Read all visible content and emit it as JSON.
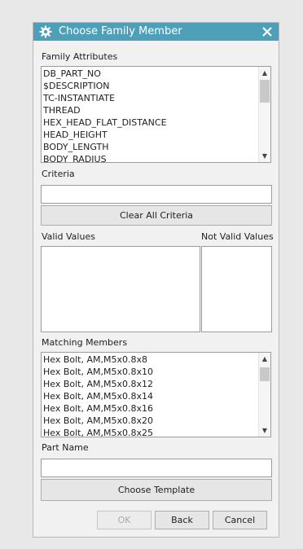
{
  "dialog": {
    "title": "Choose Family Member",
    "title_icon": "gear-icon",
    "close_icon": "close-icon"
  },
  "family_attributes": {
    "label": "Family Attributes",
    "items": [
      "DB_PART_NO",
      "$DESCRIPTION",
      "TC-INSTANTIATE",
      "THREAD",
      "HEX_HEAD_FLAT_DISTANCE",
      "HEAD_HEIGHT",
      "BODY_LENGTH",
      "BODY_RADIUS"
    ]
  },
  "criteria": {
    "label": "Criteria",
    "value": "",
    "clear_button": "Clear All Criteria"
  },
  "values": {
    "valid_label": "Valid Values",
    "not_valid_label": "Not Valid Values"
  },
  "matching_members": {
    "label": "Matching Members",
    "items": [
      "Hex Bolt, AM,M5x0.8x8",
      "Hex Bolt, AM,M5x0.8x10",
      "Hex Bolt, AM,M5x0.8x12",
      "Hex Bolt, AM,M5x0.8x14",
      "Hex Bolt, AM,M5x0.8x16",
      "Hex Bolt, AM,M5x0.8x20",
      "Hex Bolt, AM,M5x0.8x25"
    ]
  },
  "part_name": {
    "label": "Part Name",
    "value": "",
    "choose_template_button": "Choose Template"
  },
  "footer": {
    "ok": "OK",
    "back": "Back",
    "cancel": "Cancel"
  },
  "colors": {
    "titlebar": "#4da0b8",
    "dialog_bg": "#f1f1f1"
  }
}
